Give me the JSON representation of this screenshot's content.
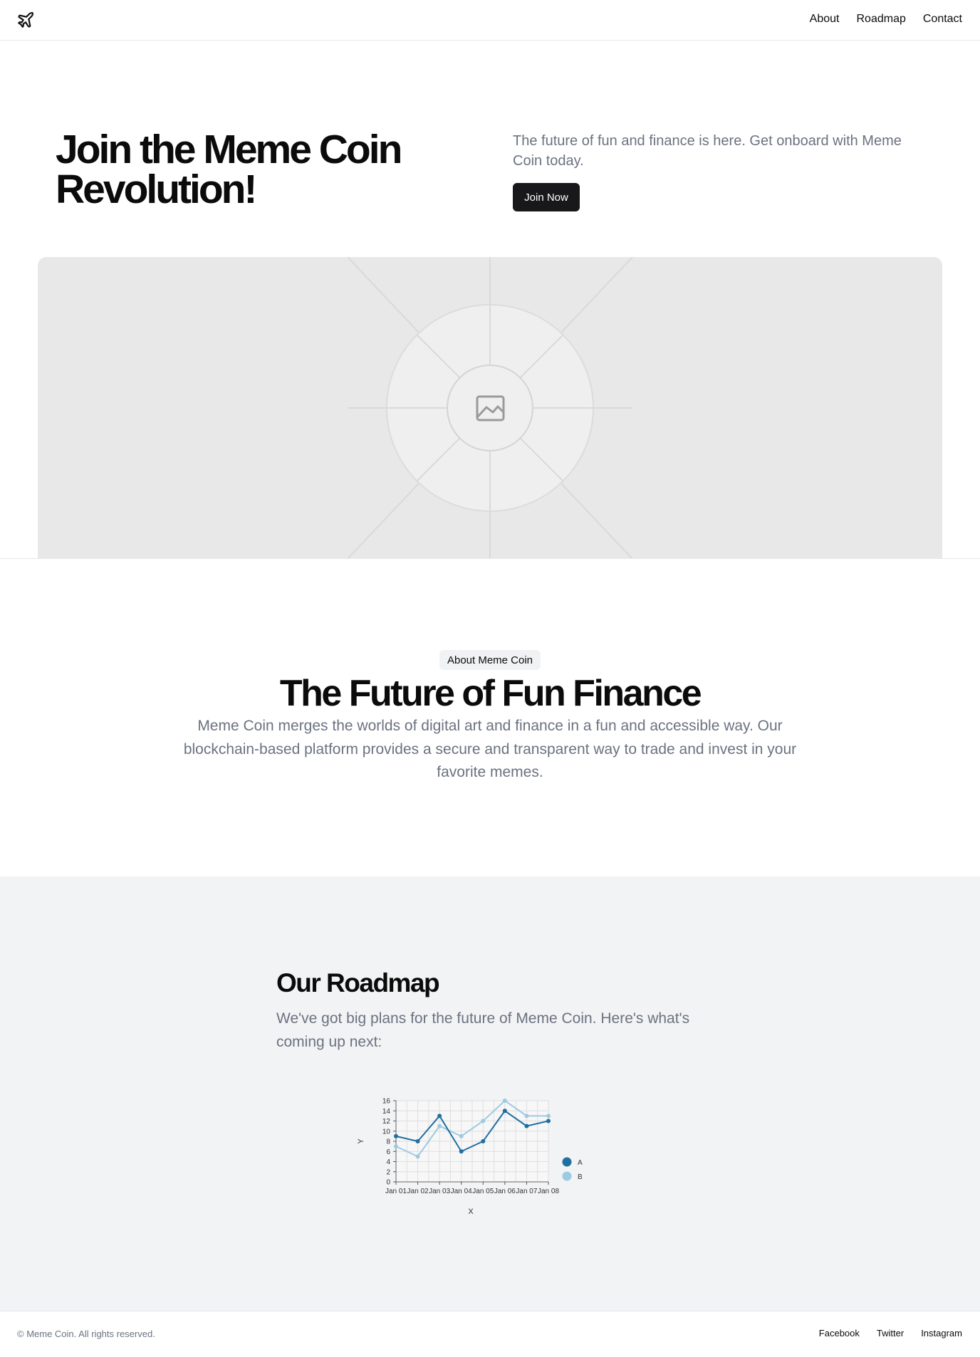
{
  "header": {
    "logo_icon": "plane-icon",
    "nav": [
      "About",
      "Roadmap",
      "Contact"
    ]
  },
  "hero": {
    "title": "Join the Meme Coin Revolution!",
    "subtitle": "The future of fun and finance is here. Get onboard with Meme Coin today.",
    "button": "Join Now",
    "image_icon": "image-placeholder-icon"
  },
  "about": {
    "badge": "About Meme Coin",
    "title": "The Future of Fun Finance",
    "text": "Meme Coin merges the worlds of digital art and finance in a fun and accessible way. Our blockchain-based platform provides a secure and transparent way to trade and invest in your favorite memes."
  },
  "roadmap": {
    "title": "Our Roadmap",
    "text": "We've got big plans for the future of Meme Coin. Here's what's coming up next:"
  },
  "chart_data": {
    "type": "line",
    "x": [
      "Jan 01",
      "Jan 02",
      "Jan 03",
      "Jan 04",
      "Jan 05",
      "Jan 06",
      "Jan 07",
      "Jan 08"
    ],
    "series": [
      {
        "name": "A",
        "values": [
          9,
          8,
          13,
          6,
          8,
          14,
          11,
          12
        ],
        "color": "#1f6f9f"
      },
      {
        "name": "B",
        "values": [
          7,
          5,
          11,
          9,
          12,
          16,
          13,
          13
        ],
        "color": "#9ecae1"
      }
    ],
    "xlabel": "X",
    "ylabel": "Y",
    "ylim": [
      0,
      16
    ],
    "yticks": [
      0,
      2,
      4,
      6,
      8,
      10,
      12,
      14,
      16
    ],
    "grid": true,
    "legend": "right"
  },
  "footer": {
    "copyright": "© Meme Coin. All rights reserved.",
    "links": [
      "Facebook",
      "Twitter",
      "Instagram"
    ]
  }
}
